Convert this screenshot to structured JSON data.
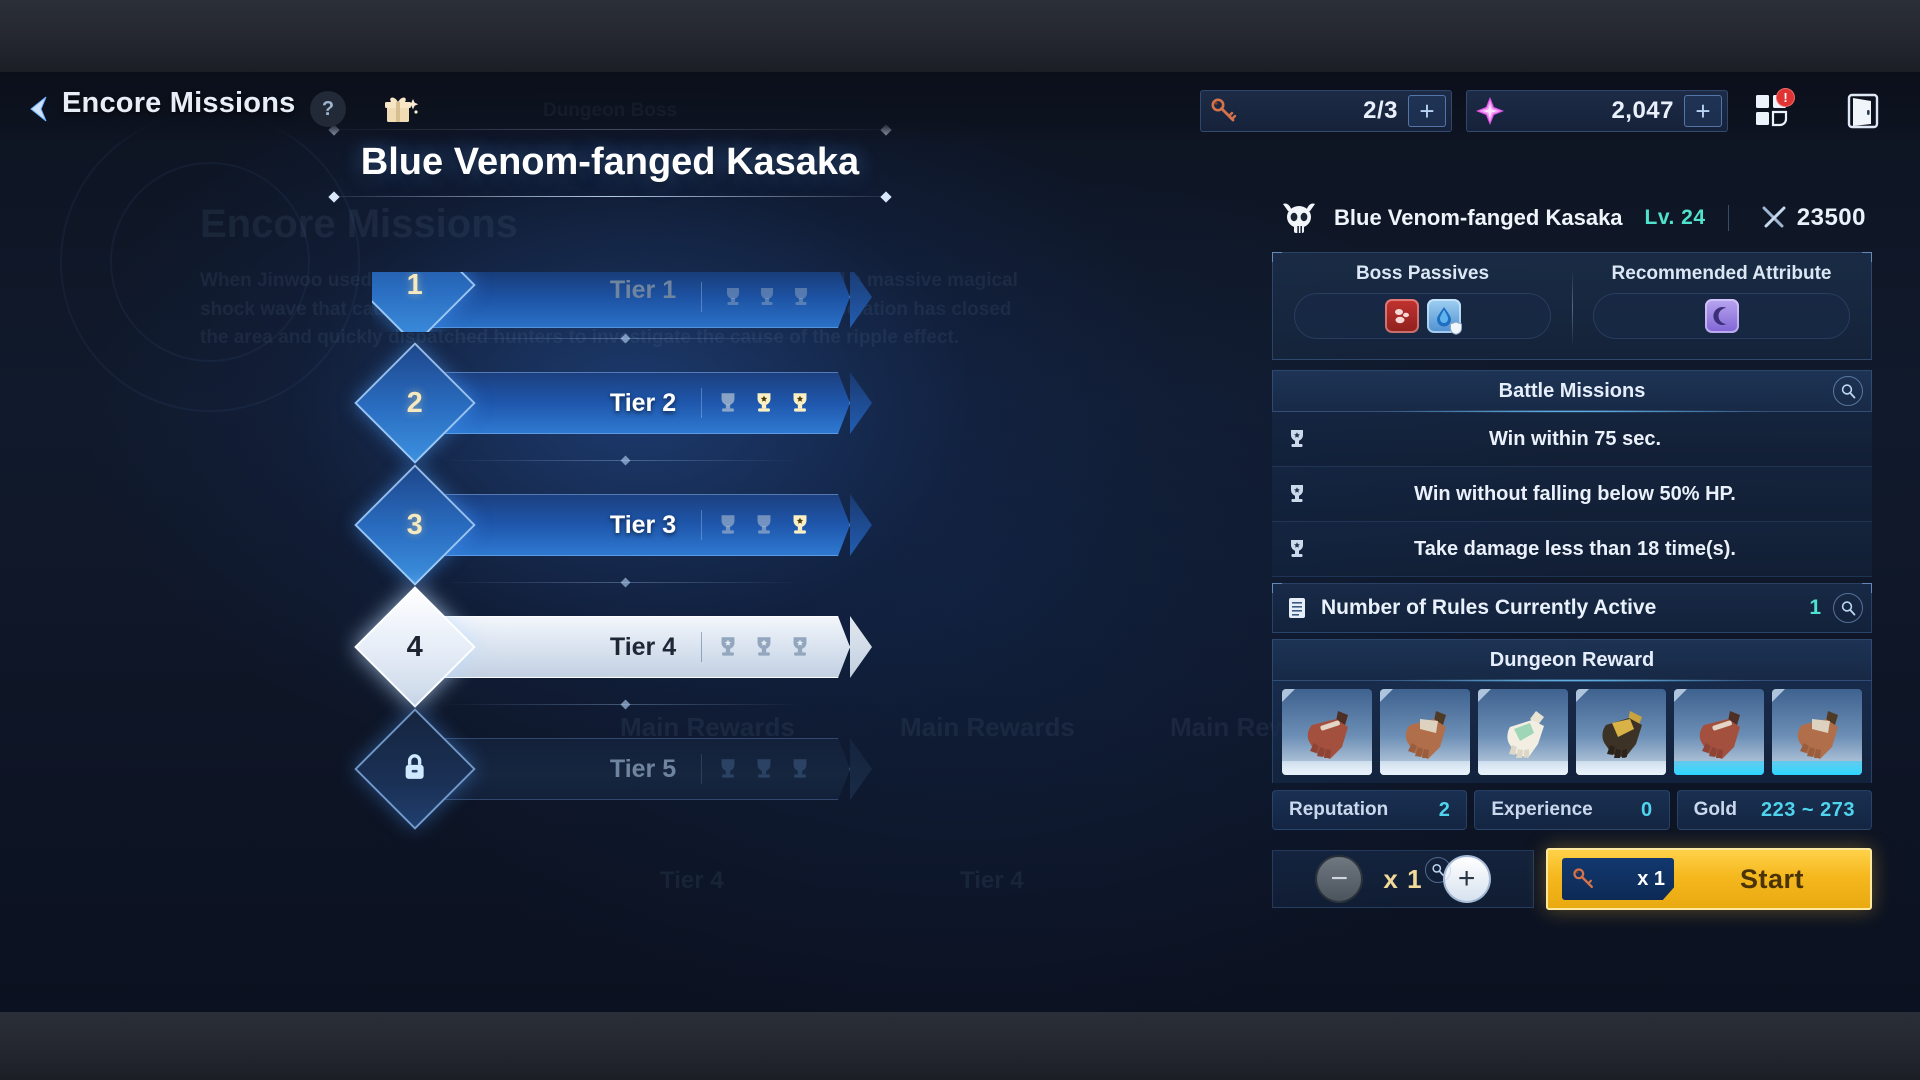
{
  "header": {
    "back_icon": "back-chevron-icon",
    "title": "Encore Missions",
    "help_label": "?",
    "gift_icon": "gift-icon",
    "currencies": [
      {
        "icon": "key-icon",
        "value": "2/3",
        "plus": "+"
      },
      {
        "icon": "crystal-icon",
        "value": "2,047",
        "plus": "+"
      }
    ],
    "grid_button": {
      "icon": "grid-menu-icon",
      "badge": "!"
    },
    "exit_button": {
      "icon": "door-exit-icon"
    }
  },
  "boss_banner": {
    "kicker": "Dungeon Boss",
    "name": "Blue Venom-fanged Kasaka"
  },
  "tiers": [
    {
      "number": "1",
      "label": "Tier 1",
      "state": "clipped",
      "trophies": [
        "off",
        "off",
        "off"
      ]
    },
    {
      "number": "2",
      "label": "Tier 2",
      "state": "unlocked",
      "trophies": [
        "off",
        "on",
        "on"
      ]
    },
    {
      "number": "3",
      "label": "Tier 3",
      "state": "unlocked",
      "trophies": [
        "off",
        "off",
        "on"
      ]
    },
    {
      "number": "4",
      "label": "Tier 4",
      "state": "selected",
      "trophies": [
        "off",
        "off",
        "off"
      ]
    },
    {
      "number": "5",
      "label": "Tier 5",
      "state": "locked",
      "trophies": [
        "off",
        "off",
        "off"
      ],
      "lock_icon": "lock-icon"
    }
  ],
  "detail": {
    "boss": {
      "icon": "skull-horns-icon",
      "name": "Blue Venom-fanged Kasaka",
      "level": "Lv. 24",
      "power_icon": "crossed-swords-icon",
      "power": "23500"
    },
    "passives": {
      "boss_passives_title": "Boss Passives",
      "boss_passive_icons": [
        "blood-drop-icon",
        "water-shield-icon"
      ],
      "recommended_title": "Recommended Attribute",
      "recommended_icons": [
        "moon-icon"
      ]
    },
    "battle_missions": {
      "title": "Battle Missions",
      "search_icon": "magnifier-icon",
      "items": [
        {
          "icon": "trophy-icon",
          "text": "Win within 75 sec."
        },
        {
          "icon": "trophy-icon",
          "text": "Win without falling below 50% HP."
        },
        {
          "icon": "trophy-icon",
          "text": "Take damage less than 18 time(s)."
        }
      ]
    },
    "rules": {
      "icon": "scroll-icon",
      "label": "Number of Rules Currently Active",
      "count": "1",
      "search_icon": "magnifier-icon"
    },
    "dungeon_reward": {
      "title": "Dungeon Reward",
      "items": [
        {
          "icon": "gauntlet-red-icon",
          "rarity": "common"
        },
        {
          "icon": "gauntlet-tan-icon",
          "rarity": "common"
        },
        {
          "icon": "gauntlet-silver-icon",
          "rarity": "common"
        },
        {
          "icon": "gauntlet-gold-icon",
          "rarity": "common"
        },
        {
          "icon": "gauntlet-red-icon",
          "rarity": "rare"
        },
        {
          "icon": "gauntlet-tan-icon",
          "rarity": "rare"
        }
      ],
      "stats": [
        {
          "name": "Reputation",
          "value": "2"
        },
        {
          "name": "Experience",
          "value": "0"
        },
        {
          "name": "Gold",
          "value": "223 ~ 273"
        }
      ]
    },
    "actions": {
      "minus_label": "−",
      "plus_label": "+",
      "quantity": "x 1",
      "quantity_search_icon": "magnifier-icon",
      "start_key_icon": "key-icon",
      "start_key_cost": "x 1",
      "start_label": "Start"
    }
  },
  "colors": {
    "accent_teal": "#4fe3cd",
    "accent_gold": "#f5b81e",
    "accent_blue": "#2f7ad2",
    "alert_red": "#e03434"
  }
}
